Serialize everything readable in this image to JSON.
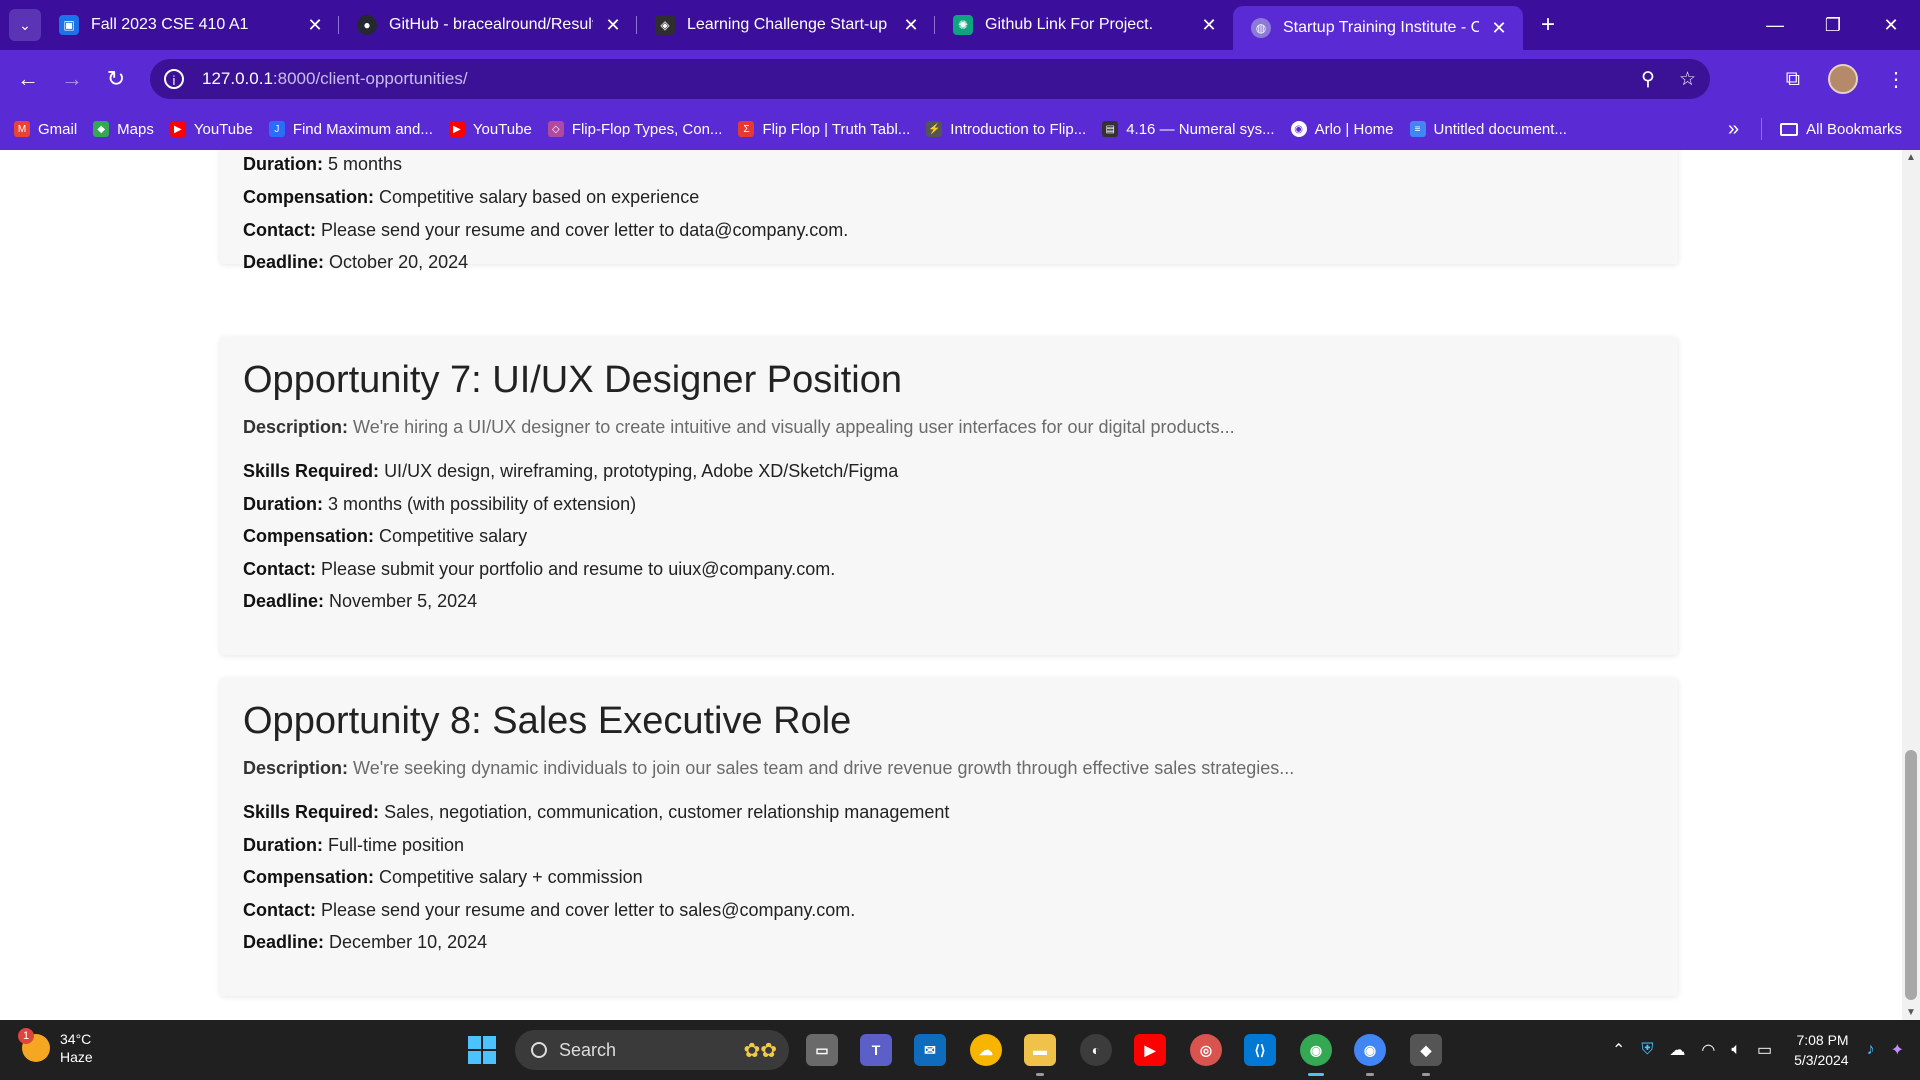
{
  "browser": {
    "tabs": [
      {
        "title": "Fall 2023 CSE 410 A1",
        "icon": "classroom-icon",
        "color": "#1a73e8"
      },
      {
        "title": "GitHub - bracealround/Result_F",
        "icon": "github-icon",
        "color": "#24292f"
      },
      {
        "title": "Learning Challenge Start-up",
        "icon": "learning-icon",
        "color": "#2e2e2e"
      },
      {
        "title": "Github Link For Project.",
        "icon": "chatgpt-icon",
        "color": "#10a37f"
      },
      {
        "title": "Startup Training Institute - Clien",
        "icon": "globe-icon",
        "color": "#8c7ad9"
      }
    ],
    "url_host": "127.0.0.1",
    "url_rest": ":8000/client-opportunities/",
    "bookmarks": [
      {
        "label": "Gmail",
        "color": "#ea4335"
      },
      {
        "label": "Maps",
        "color": "#34a853"
      },
      {
        "label": "YouTube",
        "color": "#ff0000"
      },
      {
        "label": "Find Maximum and...",
        "color": "#2b6cff"
      },
      {
        "label": "YouTube",
        "color": "#ff0000"
      },
      {
        "label": "Flip-Flop Types, Con...",
        "color": "#b04aa0"
      },
      {
        "label": "Flip Flop | Truth Tabl...",
        "color": "#e53935"
      },
      {
        "label": "Introduction to Flip...",
        "color": "#555555"
      },
      {
        "label": "4.16 — Numeral sys...",
        "color": "#333333"
      },
      {
        "label": "Arlo | Home",
        "color": "#ffffff"
      },
      {
        "label": "Untitled document...",
        "color": "#4285f4"
      }
    ],
    "all_bookmarks": "All Bookmarks"
  },
  "page": {
    "labels": {
      "description": "Description:",
      "skills": "Skills Required:",
      "duration": "Duration:",
      "compensation": "Compensation:",
      "contact": "Contact:",
      "deadline": "Deadline:"
    },
    "partial_card": {
      "duration": "5 months",
      "compensation": "Competitive salary based on experience",
      "contact": "Please send your resume and cover letter to data@company.com.",
      "deadline": "October 20, 2024"
    },
    "opportunities": [
      {
        "title": "Opportunity 7: UI/UX Designer Position",
        "description": "We're hiring a UI/UX designer to create intuitive and visually appealing user interfaces for our digital products...",
        "skills": "UI/UX design, wireframing, prototyping, Adobe XD/Sketch/Figma",
        "duration": "3 months (with possibility of extension)",
        "compensation": "Competitive salary",
        "contact": "Please submit your portfolio and resume to uiux@company.com.",
        "deadline": "November 5, 2024"
      },
      {
        "title": "Opportunity 8: Sales Executive Role",
        "description": "We're seeking dynamic individuals to join our sales team and drive revenue growth through effective sales strategies...",
        "skills": "Sales, negotiation, communication, customer relationship management",
        "duration": "Full-time position",
        "compensation": "Competitive salary + commission",
        "contact": "Please send your resume and cover letter to sales@company.com.",
        "deadline": "December 10, 2024"
      }
    ]
  },
  "taskbar": {
    "weather_temp": "34°C",
    "weather_desc": "Haze",
    "weather_badge": "1",
    "search_placeholder": "Search",
    "time": "7:08 PM",
    "date": "5/3/2024"
  }
}
